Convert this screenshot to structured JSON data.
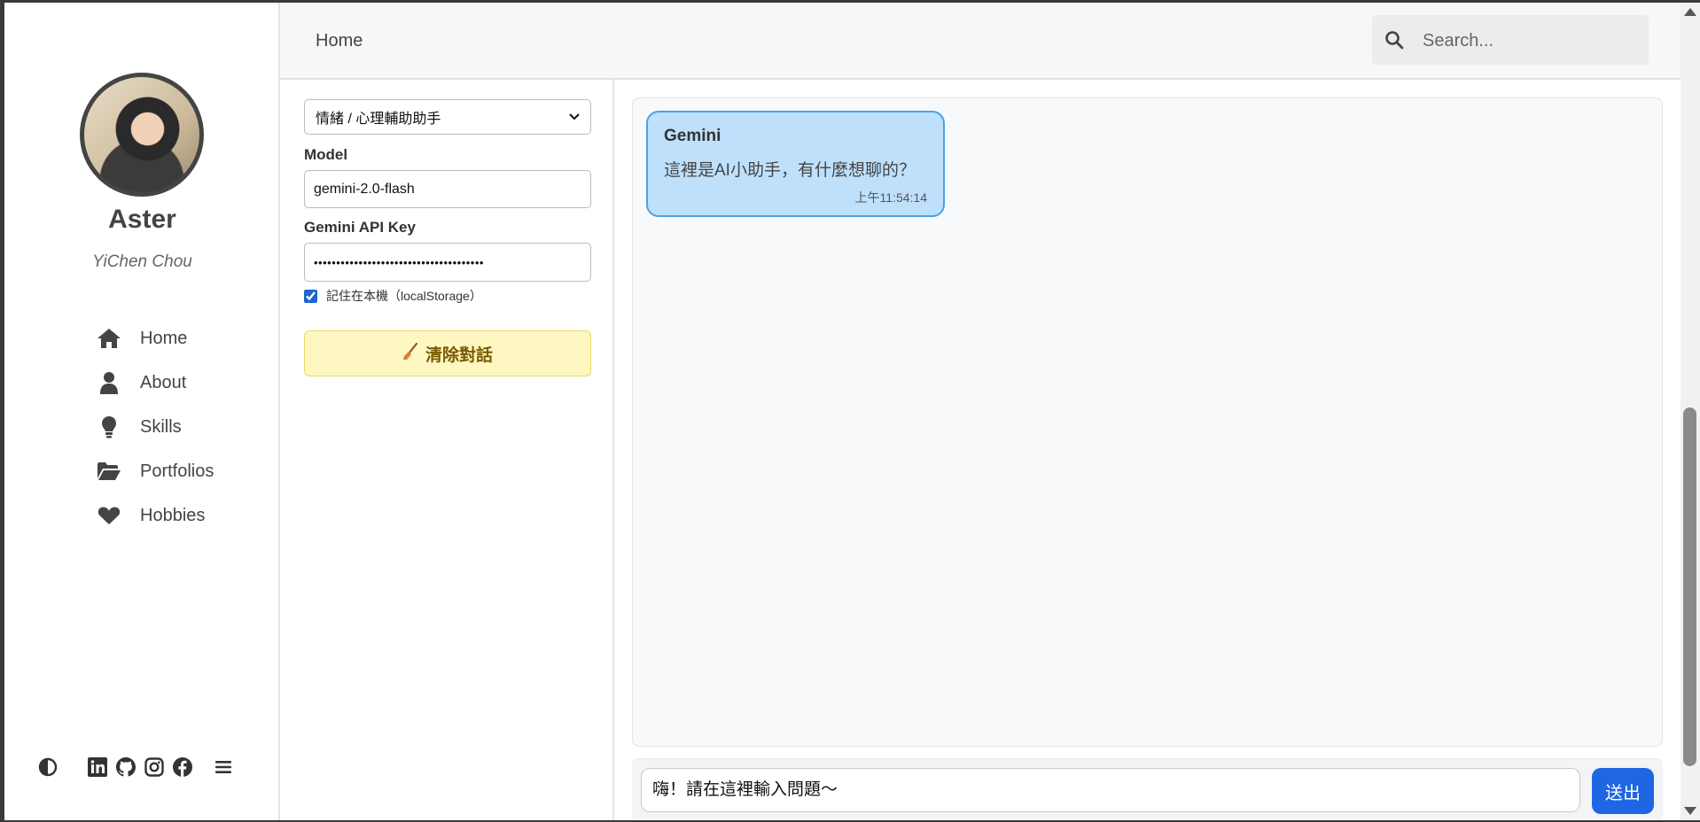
{
  "profile": {
    "name": "Aster",
    "subtitle": "YiChen Chou"
  },
  "sidebar": {
    "items": [
      {
        "label": "Home",
        "icon": "home-icon"
      },
      {
        "label": "About",
        "icon": "user-icon"
      },
      {
        "label": "Skills",
        "icon": "lightbulb-icon"
      },
      {
        "label": "Portfolios",
        "icon": "folder-icon"
      },
      {
        "label": "Hobbies",
        "icon": "heart-icon"
      }
    ],
    "footer_icons": [
      "theme-toggle-icon",
      "linkedin-icon",
      "github-icon",
      "instagram-icon",
      "facebook-icon",
      "menu-icon"
    ]
  },
  "header": {
    "breadcrumb": "Home",
    "search_placeholder": "Search..."
  },
  "settings": {
    "persona_selected": "情緒 / 心理輔助助手",
    "model_label": "Model",
    "model_value": "gemini-2.0-flash",
    "api_key_label": "Gemini API Key",
    "api_key_value": "••••••••••••••••••••••••••••••••••••••",
    "remember_label": "記住在本機（localStorage）",
    "remember_checked": true,
    "clear_label": "清除對話"
  },
  "chat": {
    "messages": [
      {
        "sender": "Gemini",
        "text": "這裡是AI小助手，有什麼想聊的？",
        "time": "上午11:54:14"
      }
    ],
    "input_placeholder": "嗨！請在這裡輸入問題～",
    "send_label": "送出"
  },
  "colors": {
    "accent": "#1f66e5",
    "bubble_bg": "#bfe0fb",
    "bubble_border": "#46a3e8",
    "clear_bg": "#fff7c2"
  }
}
